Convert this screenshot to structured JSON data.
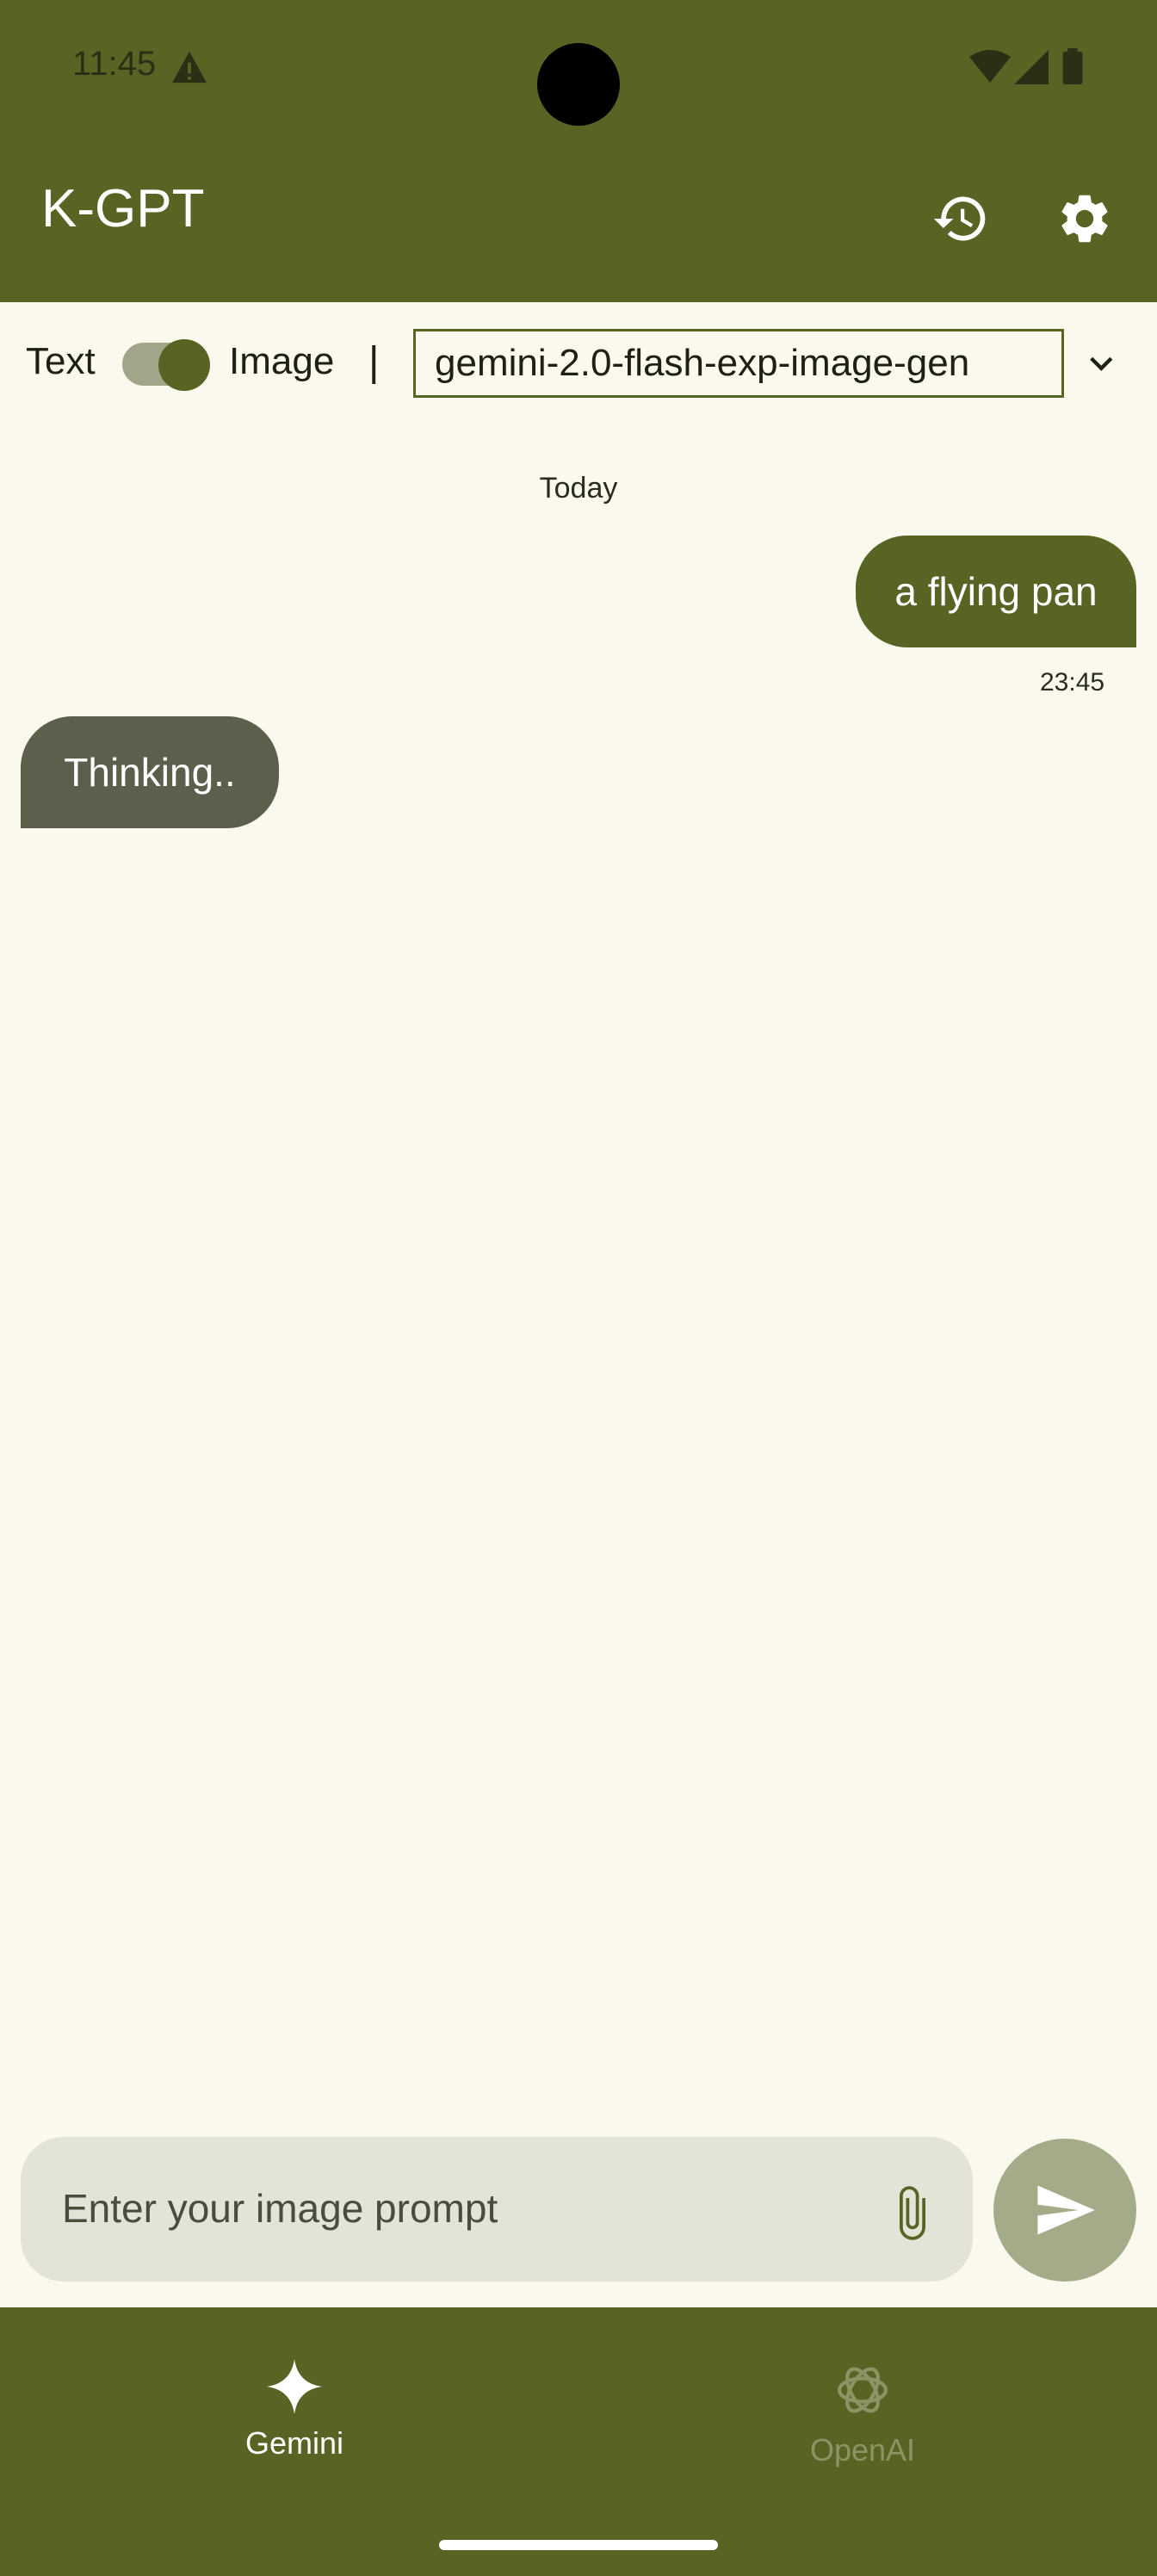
{
  "status_bar": {
    "time": "11:45"
  },
  "app_bar": {
    "title": "K-GPT"
  },
  "mode": {
    "text_label": "Text",
    "image_label": "Image",
    "divider": "|",
    "toggle_on": true,
    "model": "gemini-2.0-flash-exp-image-gen"
  },
  "chat": {
    "date_label": "Today",
    "messages": [
      {
        "role": "user",
        "text": "a flying pan",
        "time": "23:45"
      },
      {
        "role": "assistant",
        "text": "Thinking.."
      }
    ]
  },
  "input": {
    "placeholder": "Enter your image prompt"
  },
  "bottom_nav": {
    "items": [
      {
        "label": "Gemini",
        "icon": "sparkle-icon",
        "active": true
      },
      {
        "label": "OpenAI",
        "icon": "openai-icon",
        "active": false
      }
    ]
  },
  "colors": {
    "primary": "#586424",
    "background": "#FBF9EE",
    "assistant_bubble": "#5B5F4C",
    "input_bg": "#E3E3D7",
    "send_button": "#A3AB88"
  }
}
